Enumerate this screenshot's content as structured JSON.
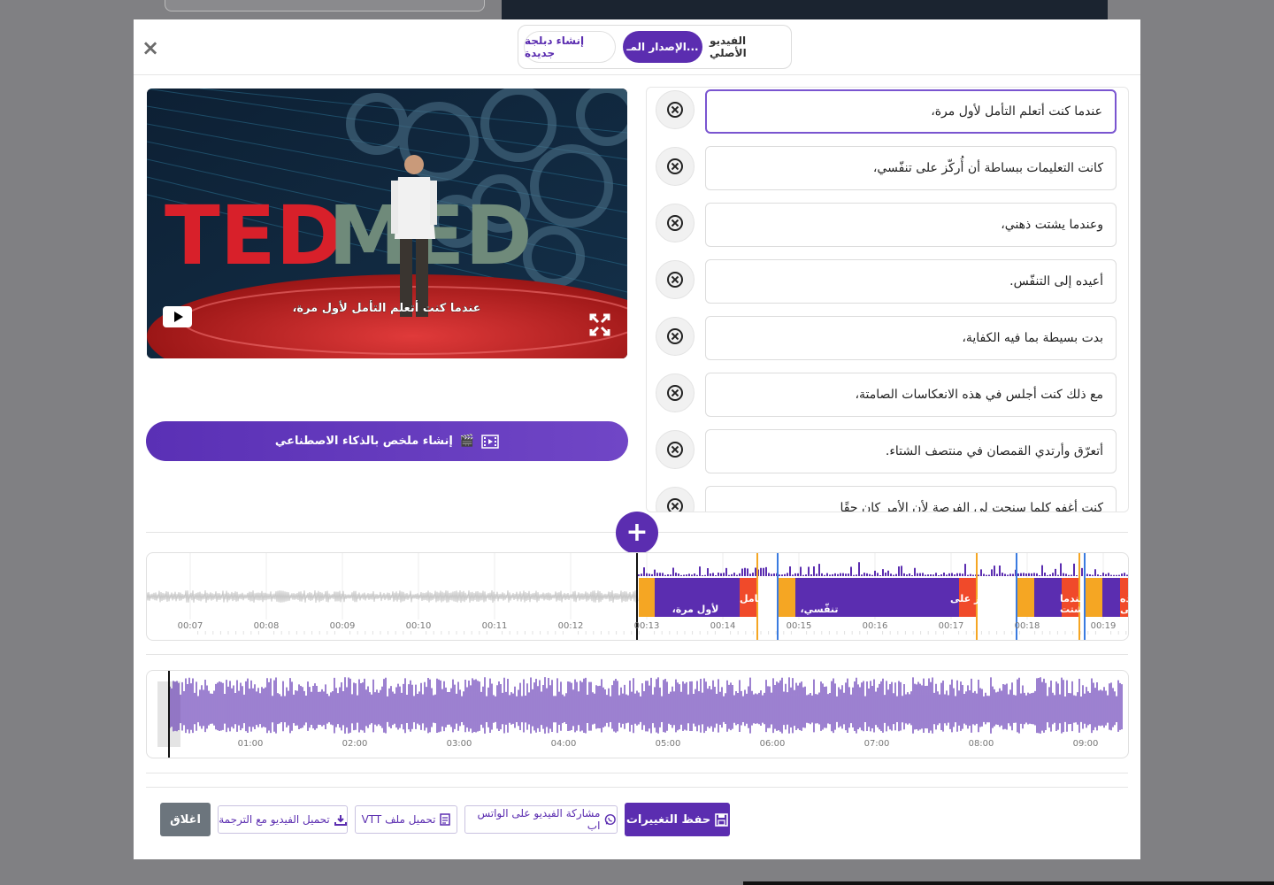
{
  "modal": {
    "tabs": [
      {
        "label": "الفيديو الأصلي"
      },
      {
        "label": "الإصدار المـ..."
      },
      {
        "label": "إنشاء دبلجة جديدة"
      }
    ]
  },
  "video": {
    "caption": "عندما كنت أتعلم التأمل لأول مرة،",
    "stage_logo_left": "TED",
    "stage_logo_right": "MED"
  },
  "ai_summary_button": {
    "label": "إنشاء ملخص بالذكاء الاصطناعي",
    "icon": "🎬"
  },
  "subtitles": [
    {
      "text": "عندما كنت أتعلم التأمل لأول مرة،"
    },
    {
      "text": "كانت التعليمات ببساطة أن أُركّز على تنفّسي،"
    },
    {
      "text": "وعندما يشتت ذهني،"
    },
    {
      "text": "أعيده إلى التنفّس."
    },
    {
      "text": "بدت بسيطة بما فيه الكفاية،"
    },
    {
      "text": "مع ذلك كنت أجلس في هذه الانعكاسات الصامتة،"
    },
    {
      "text": "أتعرّق وأرتدي القمصان في منتصف الشتاء."
    },
    {
      "text": "كنت أغفو كلما سنحت لي الفرصة لأن الأمر كان حقًا"
    }
  ],
  "timeline": {
    "ticks": [
      "00:07",
      "00:08",
      "00:09",
      "00:10",
      "00:11",
      "00:12",
      "00:13",
      "00:14",
      "00:15",
      "00:16",
      "00:17",
      "00:18",
      "00:19"
    ],
    "segments": [
      {
        "label_line1": "ما كنت اتعلم التامل",
        "label_line2": "لأول مرة،"
      },
      {
        "label_line1": "كانت التعليمات ببساطة ان أُركّز على",
        "label_line2": "تنفّسي،"
      },
      {
        "label_line1": "عندما",
        "label_line2": "يشتت"
      },
      {
        "label_line1": "عيده",
        "label_line2": "إلى"
      }
    ]
  },
  "overview": {
    "ticks": [
      "01:00",
      "02:00",
      "03:00",
      "04:00",
      "05:00",
      "06:00",
      "07:00",
      "08:00",
      "09:00"
    ]
  },
  "actions": {
    "close": "اغلاق",
    "download_video": "تحميل الفيديو مع الترجمة",
    "download_vtt": "تحميل ملف VTT",
    "share_whatsapp": "مشاركة الفيديو على الواتس اب",
    "save": "حفظ التغييرات"
  },
  "colors": {
    "accent": "#5b2db0",
    "waveform_active": "#5b2db0",
    "waveform_inactive": "#c8c8c8",
    "segment_orange": "#f5a623",
    "segment_red": "#f04a2a",
    "close_button": "#6c757d"
  }
}
